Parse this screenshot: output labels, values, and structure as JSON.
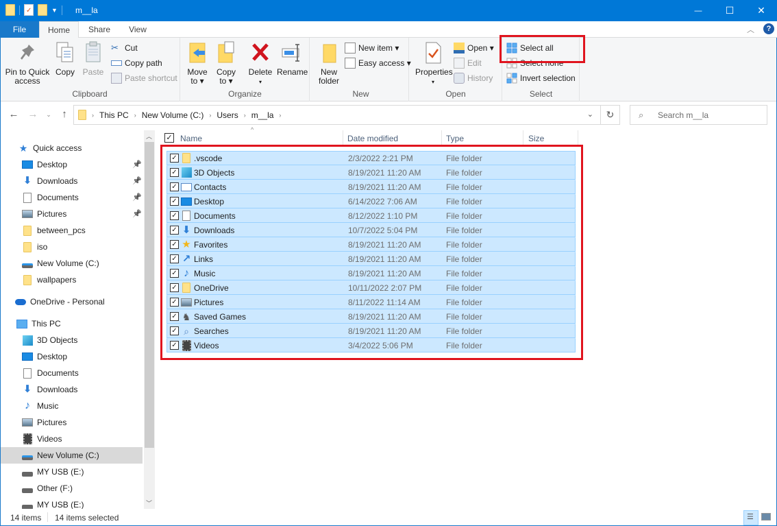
{
  "window": {
    "title": "m__la",
    "controls": {
      "minimize": "—",
      "maximize": "☐",
      "close": "✕"
    },
    "help": "?"
  },
  "ribbon_tabs": [
    {
      "label": "File"
    },
    {
      "label": "Home",
      "active": true
    },
    {
      "label": "Share"
    },
    {
      "label": "View"
    }
  ],
  "ribbon": {
    "clipboard": {
      "label": "Clipboard",
      "pin": "Pin to Quick access",
      "pin_l1": "Pin to Quick",
      "pin_l2": "access",
      "copy": "Copy",
      "paste": "Paste",
      "cut": "Cut",
      "copy_path": "Copy path",
      "paste_shortcut": "Paste shortcut"
    },
    "organize": {
      "label": "Organize",
      "move_l1": "Move",
      "move_l2": "to ▾",
      "copy_l1": "Copy",
      "copy_l2": "to ▾",
      "delete": "Delete",
      "delete_arrow": "▾",
      "rename": "Rename"
    },
    "new": {
      "label": "New",
      "new_folder_l1": "New",
      "new_folder_l2": "folder",
      "new_item": "New item ▾",
      "easy_access": "Easy access ▾"
    },
    "open": {
      "label": "Open",
      "properties": "Properties",
      "properties_arrow": "▾",
      "open": "Open ▾",
      "edit": "Edit",
      "history": "History"
    },
    "select": {
      "label": "Select",
      "select_all": "Select all",
      "select_none": "Select none",
      "invert": "Invert selection"
    }
  },
  "address": {
    "breadcrumbs": [
      "This PC",
      "New Volume (C:)",
      "Users",
      "m__la"
    ],
    "search_placeholder": "Search m__la"
  },
  "nav": {
    "quick_access": "Quick access",
    "quick_items": [
      {
        "label": "Desktop",
        "icon": "desktop",
        "pinned": true
      },
      {
        "label": "Downloads",
        "icon": "downloads",
        "pinned": true
      },
      {
        "label": "Documents",
        "icon": "documents",
        "pinned": true
      },
      {
        "label": "Pictures",
        "icon": "pictures",
        "pinned": true
      },
      {
        "label": "between_pcs",
        "icon": "folder"
      },
      {
        "label": "iso",
        "icon": "folder"
      },
      {
        "label": "New Volume (C:)",
        "icon": "drive"
      },
      {
        "label": "wallpapers",
        "icon": "folder"
      }
    ],
    "onedrive": "OneDrive - Personal",
    "this_pc": "This PC",
    "pc_items": [
      {
        "label": "3D Objects",
        "icon": "3d"
      },
      {
        "label": "Desktop",
        "icon": "desktop"
      },
      {
        "label": "Documents",
        "icon": "documents"
      },
      {
        "label": "Downloads",
        "icon": "downloads"
      },
      {
        "label": "Music",
        "icon": "music"
      },
      {
        "label": "Pictures",
        "icon": "pictures"
      },
      {
        "label": "Videos",
        "icon": "videos"
      },
      {
        "label": "New Volume (C:)",
        "icon": "drive",
        "selected": true
      },
      {
        "label": "MY USB (E:)",
        "icon": "usb"
      },
      {
        "label": "Other (F:)",
        "icon": "usb"
      },
      {
        "label": "MY USB (E:)",
        "icon": "usb"
      }
    ]
  },
  "columns": {
    "name": "Name",
    "date": "Date modified",
    "type": "Type",
    "size": "Size"
  },
  "files": [
    {
      "name": ".vscode",
      "date": "2/3/2022 2:21 PM",
      "type": "File folder",
      "icon": "folder"
    },
    {
      "name": "3D Objects",
      "date": "8/19/2021 11:20 AM",
      "type": "File folder",
      "icon": "3d"
    },
    {
      "name": "Contacts",
      "date": "8/19/2021 11:20 AM",
      "type": "File folder",
      "icon": "contacts"
    },
    {
      "name": "Desktop",
      "date": "6/14/2022 7:06 AM",
      "type": "File folder",
      "icon": "desktop"
    },
    {
      "name": "Documents",
      "date": "8/12/2022 1:10 PM",
      "type": "File folder",
      "icon": "documents"
    },
    {
      "name": "Downloads",
      "date": "10/7/2022 5:04 PM",
      "type": "File folder",
      "icon": "downloads"
    },
    {
      "name": "Favorites",
      "date": "8/19/2021 11:20 AM",
      "type": "File folder",
      "icon": "favorites"
    },
    {
      "name": "Links",
      "date": "8/19/2021 11:20 AM",
      "type": "File folder",
      "icon": "links"
    },
    {
      "name": "Music",
      "date": "8/19/2021 11:20 AM",
      "type": "File folder",
      "icon": "music"
    },
    {
      "name": "OneDrive",
      "date": "10/11/2022 2:07 PM",
      "type": "File folder",
      "icon": "folder"
    },
    {
      "name": "Pictures",
      "date": "8/11/2022 11:14 AM",
      "type": "File folder",
      "icon": "pictures"
    },
    {
      "name": "Saved Games",
      "date": "8/19/2021 11:20 AM",
      "type": "File folder",
      "icon": "savedgames"
    },
    {
      "name": "Searches",
      "date": "8/19/2021 11:20 AM",
      "type": "File folder",
      "icon": "searches"
    },
    {
      "name": "Videos",
      "date": "3/4/2022 5:06 PM",
      "type": "File folder",
      "icon": "videos"
    }
  ],
  "status": {
    "count": "14 items",
    "selected": "14 items selected"
  },
  "colors": {
    "accent": "#0078d7",
    "selection": "#cce8ff",
    "highlight": "#e0141e"
  }
}
